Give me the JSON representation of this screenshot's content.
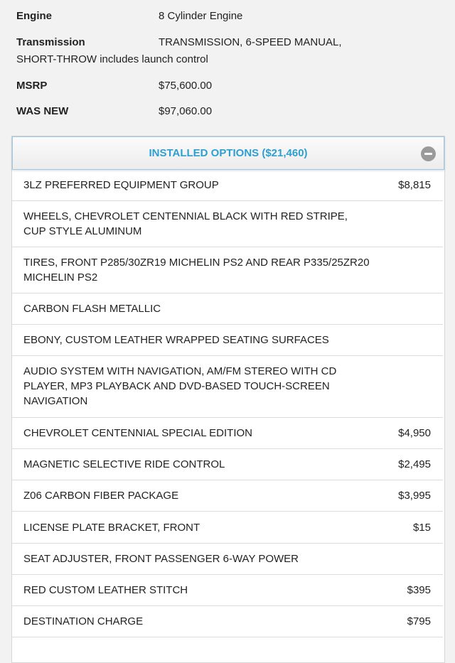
{
  "specs": {
    "engine_label": "Engine",
    "engine_value": "8 Cylinder Engine",
    "transmission_label": "Transmission",
    "transmission_value_line1": "TRANSMISSION, 6-SPEED MANUAL,",
    "transmission_value_line2": "SHORT-THROW includes launch control",
    "msrp_label": "MSRP",
    "msrp_value": "$75,600.00",
    "was_new_label": "WAS NEW",
    "was_new_value": "$97,060.00"
  },
  "options": {
    "title": "INSTALLED OPTIONS ($21,460)",
    "icon": "minus-circle-icon",
    "accent_color": "#2e9fd0",
    "items": [
      {
        "name": "3LZ PREFERRED EQUIPMENT GROUP",
        "price": "$8,815"
      },
      {
        "name": "WHEELS, CHEVROLET CENTENNIAL BLACK WITH RED STRIPE, CUP STYLE ALUMINUM",
        "price": ""
      },
      {
        "name": "TIRES, FRONT P285/30ZR19 MICHELIN PS2 AND REAR P335/25ZR20 MICHELIN PS2",
        "price": ""
      },
      {
        "name": "CARBON FLASH METALLIC",
        "price": ""
      },
      {
        "name": "EBONY, CUSTOM LEATHER WRAPPED SEATING SURFACES",
        "price": ""
      },
      {
        "name": "AUDIO SYSTEM WITH NAVIGATION, AM/FM STEREO WITH CD PLAYER, MP3 PLAYBACK AND DVD-BASED TOUCH-SCREEN NAVIGATION",
        "price": ""
      },
      {
        "name": "CHEVROLET CENTENNIAL SPECIAL EDITION",
        "price": "$4,950"
      },
      {
        "name": "MAGNETIC SELECTIVE RIDE CONTROL",
        "price": "$2,495"
      },
      {
        "name": "Z06 CARBON FIBER PACKAGE",
        "price": "$3,995"
      },
      {
        "name": "LICENSE PLATE BRACKET, FRONT",
        "price": "$15"
      },
      {
        "name": "SEAT ADJUSTER, FRONT PASSENGER 6-WAY POWER",
        "price": ""
      },
      {
        "name": "RED CUSTOM LEATHER STITCH",
        "price": "$395"
      },
      {
        "name": "DESTINATION CHARGE",
        "price": "$795"
      }
    ]
  }
}
